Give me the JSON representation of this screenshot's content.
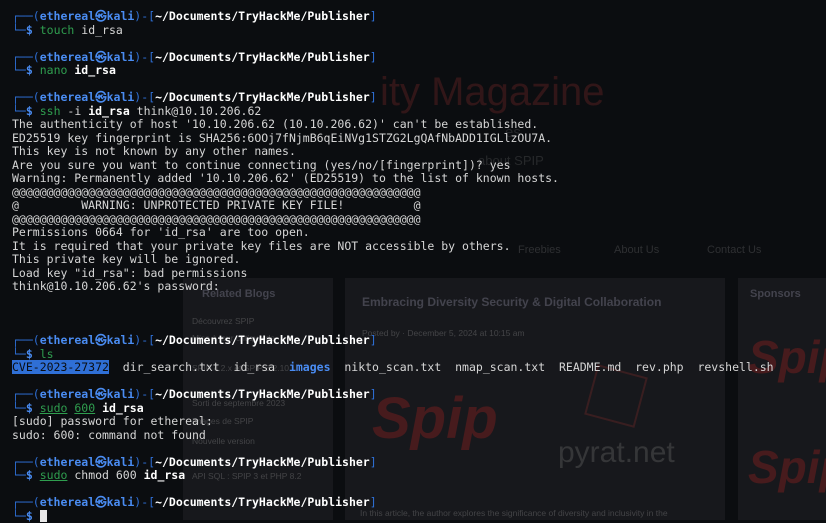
{
  "background_site": {
    "title_fragment": "ity Magazine",
    "subtitle_fragment": "es",
    "subtitle2_fragment": "about SPIP",
    "nav": [
      "Freebies",
      "About Us",
      "Contact Us"
    ],
    "sidebar_heading": "Related Blogs",
    "sidebar_items": [
      "Découvrez SPIP",
      "Mise à jour critique de",
      "SPIP 4.2.x et SPIP 3.2.10",
      "Sorti de septembre 2023",
      "Images de SPIP",
      "Nouvelle version",
      "API SQL : SPIP 3 et PHP 8.2"
    ],
    "article_title": "Embracing Diversity Security & Digital Collaboration",
    "article_meta": "Posted by  ·  December 5, 2024 at 10:15 am",
    "sponsors_heading": "Sponsors",
    "logo_text_spip": "Spip",
    "logo_text_pyrat": "pyrat.net",
    "footer_text": "In this article, the author explores the significance of diversity and inclusivity in the"
  },
  "prompt": {
    "user": "ethereal",
    "at_symbol": "㉿",
    "host": "kali",
    "path": "~/Documents/TryHackMe/Publisher"
  },
  "blocks": [
    {
      "command": [
        {
          "t": "touch",
          "c": "green"
        },
        {
          "t": " id_rsa",
          "c": ""
        }
      ],
      "output": []
    },
    {
      "command": [
        {
          "t": "nano",
          "c": "green"
        },
        {
          "t": " ",
          "c": ""
        },
        {
          "t": "id_rsa",
          "c": "bold"
        }
      ],
      "output": []
    },
    {
      "command": [
        {
          "t": "ssh",
          "c": "green"
        },
        {
          "t": " -i ",
          "c": ""
        },
        {
          "t": "id_rsa",
          "c": "bold"
        },
        {
          "t": " think@10.10.206.62",
          "c": ""
        }
      ],
      "output": [
        "The authenticity of host '10.10.206.62 (10.10.206.62)' can't be established.",
        "ED25519 key fingerprint is SHA256:6OOj7fNjmB6qEiNVg1STZG2LgQAfNbADD1IGLlzOU7A.",
        "This key is not known by any other names.",
        "Are you sure you want to continue connecting (yes/no/[fingerprint])? yes",
        "Warning: Permanently added '10.10.206.62' (ED25519) to the list of known hosts.",
        "@@@@@@@@@@@@@@@@@@@@@@@@@@@@@@@@@@@@@@@@@@@@@@@@@@@@@@@@@@@",
        "@         WARNING: UNPROTECTED PRIVATE KEY FILE!          @",
        "@@@@@@@@@@@@@@@@@@@@@@@@@@@@@@@@@@@@@@@@@@@@@@@@@@@@@@@@@@@",
        "Permissions 0664 for 'id_rsa' are too open.",
        "It is required that your private key files are NOT accessible by others.",
        "This private key will be ignored.",
        "Load key \"id_rsa\": bad permissions",
        "think@10.10.206.62's password: ",
        "",
        ""
      ]
    },
    {
      "command": [
        {
          "t": "ls",
          "c": "green"
        }
      ],
      "output_rich": [
        [
          {
            "t": "CVE-2023-27372",
            "c": "hl"
          },
          {
            "t": "  dir_search.txt  id_rsa  ",
            "c": ""
          },
          {
            "t": "images",
            "c": "dir"
          },
          {
            "t": "  nikto_scan.txt  nmap_scan.txt  README.md  rev.php  revshell.sh",
            "c": ""
          }
        ]
      ]
    },
    {
      "command": [
        {
          "t": "sudo",
          "c": "green ul"
        },
        {
          "t": " ",
          "c": ""
        },
        {
          "t": "600",
          "c": "green ul"
        },
        {
          "t": " ",
          "c": ""
        },
        {
          "t": "id_rsa",
          "c": "bold"
        }
      ],
      "output": [
        "[sudo] password for ethereal: ",
        "sudo: 600: command not found"
      ]
    },
    {
      "command": [
        {
          "t": "sudo",
          "c": "green ul"
        },
        {
          "t": " chmod 600 ",
          "c": ""
        },
        {
          "t": "id_rsa",
          "c": "bold"
        }
      ],
      "output": []
    }
  ],
  "colors": {
    "prompt_frame": "#2e6fd6",
    "user_host": "#4a8cf2",
    "command": "#2f9e4f",
    "highlight": "#2f6fd6",
    "background": "#0b0d10"
  }
}
